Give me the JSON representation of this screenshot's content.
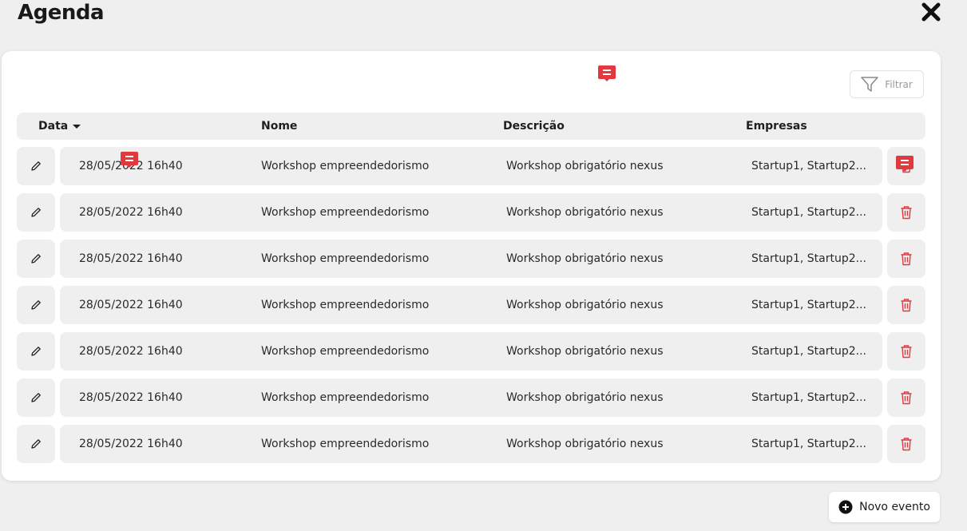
{
  "page": {
    "title": "Agenda"
  },
  "toolbar": {
    "filter_label": "Filtrar"
  },
  "table": {
    "columns": {
      "date": "Data",
      "name": "Nome",
      "description": "Descrição",
      "companies": "Empresas"
    },
    "rows": [
      {
        "date": "28/05/2022 16h40",
        "name": "Workshop empreendedorismo",
        "description": "Workshop obrigatório nexus",
        "companies": "Startup1, Startup2..."
      },
      {
        "date": "28/05/2022 16h40",
        "name": "Workshop empreendedorismo",
        "description": "Workshop obrigatório nexus",
        "companies": "Startup1, Startup2..."
      },
      {
        "date": "28/05/2022 16h40",
        "name": "Workshop empreendedorismo",
        "description": "Workshop obrigatório nexus",
        "companies": "Startup1, Startup2..."
      },
      {
        "date": "28/05/2022 16h40",
        "name": "Workshop empreendedorismo",
        "description": "Workshop obrigatório nexus",
        "companies": "Startup1, Startup2..."
      },
      {
        "date": "28/05/2022 16h40",
        "name": "Workshop empreendedorismo",
        "description": "Workshop obrigatório nexus",
        "companies": "Startup1, Startup2..."
      },
      {
        "date": "28/05/2022 16h40",
        "name": "Workshop empreendedorismo",
        "description": "Workshop obrigatório nexus",
        "companies": "Startup1, Startup2..."
      },
      {
        "date": "28/05/2022 16h40",
        "name": "Workshop empreendedorismo",
        "description": "Workshop obrigatório nexus",
        "companies": "Startup1, Startup2..."
      }
    ]
  },
  "actions": {
    "new_event_label": "Novo evento"
  },
  "icons": {
    "close": "close-icon",
    "filter": "filter-icon",
    "sort": "sort-caret-icon",
    "edit": "pencil-icon",
    "delete": "trash-icon",
    "comment": "comment-icon",
    "add": "plus-circle-icon"
  },
  "colors": {
    "accent_red": "#e0393e",
    "background": "#efefef",
    "card": "#ffffff",
    "text": "#1a1a1a"
  }
}
